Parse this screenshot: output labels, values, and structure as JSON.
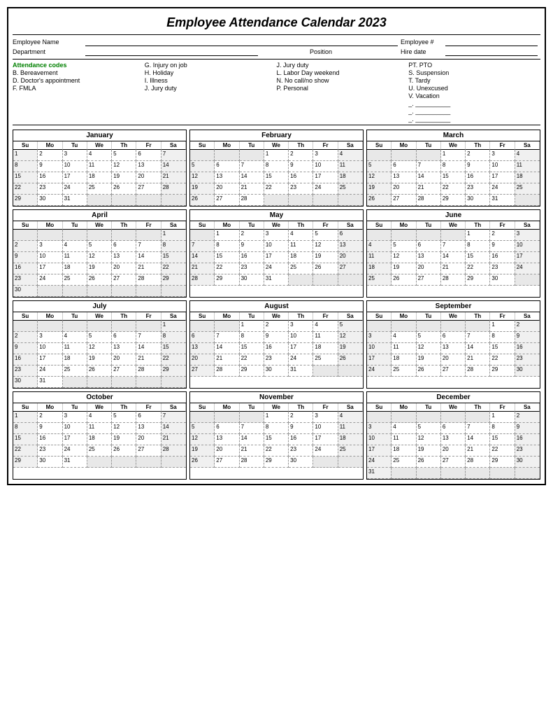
{
  "title": "Employee Attendance Calendar 2023",
  "employee_fields": {
    "name_label": "Employee Name",
    "dept_label": "Department",
    "emp_num_label": "Employee #",
    "position_label": "Position",
    "hire_date_label": "Hire date"
  },
  "codes": {
    "title": "Attendance codes",
    "col1": [
      "B. Bereavement",
      "D. Doctor's appointment",
      "F.  FMLA"
    ],
    "col2": [
      "G. Injury on job",
      "H. Holiday",
      "I.  Illness",
      "J. Jury duty"
    ],
    "col3": [
      "J. Jury duty",
      "L. Labor Day weekend",
      "N. No call/no show",
      "P. Personal"
    ],
    "col4": [
      "PT. PTO",
      "S. Suspension",
      "T. Tardy",
      "U. Unexcused",
      "V. Vacation",
      "_.  __________",
      "_.  __________",
      "_.  __________"
    ]
  },
  "months": [
    {
      "name": "January",
      "days": [
        {
          "d": 1,
          "col": 0
        },
        {
          "d": 2,
          "col": 1
        },
        {
          "d": 3,
          "col": 2
        },
        {
          "d": 4,
          "col": 3
        },
        {
          "d": 5,
          "col": 4
        },
        {
          "d": 6,
          "col": 5
        },
        {
          "d": 7,
          "col": 6
        },
        {
          "d": 8,
          "col": 0
        },
        {
          "d": 9,
          "col": 1
        },
        {
          "d": 10,
          "col": 2
        },
        {
          "d": 11,
          "col": 3
        },
        {
          "d": 12,
          "col": 4
        },
        {
          "d": 13,
          "col": 5
        },
        {
          "d": 14,
          "col": 6
        },
        {
          "d": 15,
          "col": 0
        },
        {
          "d": 16,
          "col": 1
        },
        {
          "d": 17,
          "col": 2
        },
        {
          "d": 18,
          "col": 3
        },
        {
          "d": 19,
          "col": 4
        },
        {
          "d": 20,
          "col": 5
        },
        {
          "d": 21,
          "col": 6
        },
        {
          "d": 22,
          "col": 0
        },
        {
          "d": 23,
          "col": 1
        },
        {
          "d": 24,
          "col": 2
        },
        {
          "d": 25,
          "col": 3
        },
        {
          "d": 26,
          "col": 4
        },
        {
          "d": 27,
          "col": 5
        },
        {
          "d": 28,
          "col": 6
        },
        {
          "d": 29,
          "col": 0
        },
        {
          "d": 30,
          "col": 1
        },
        {
          "d": 31,
          "col": 2
        }
      ],
      "startCol": 0,
      "totalDays": 31
    },
    {
      "name": "February",
      "startCol": 3,
      "totalDays": 28
    },
    {
      "name": "March",
      "startCol": 3,
      "totalDays": 31
    },
    {
      "name": "April",
      "startCol": 6,
      "totalDays": 30
    },
    {
      "name": "May",
      "startCol": 1,
      "totalDays": 31
    },
    {
      "name": "June",
      "startCol": 4,
      "totalDays": 30
    },
    {
      "name": "July",
      "startCol": 6,
      "totalDays": 31
    },
    {
      "name": "August",
      "startCol": 2,
      "totalDays": 31
    },
    {
      "name": "September",
      "startCol": 5,
      "totalDays": 30
    },
    {
      "name": "October",
      "startCol": 0,
      "totalDays": 31
    },
    {
      "name": "November",
      "startCol": 3,
      "totalDays": 30
    },
    {
      "name": "December",
      "startCol": 5,
      "totalDays": 31
    }
  ],
  "day_headers": [
    "Su",
    "Mo",
    "Tu",
    "We",
    "Th",
    "Fr",
    "Sa"
  ]
}
